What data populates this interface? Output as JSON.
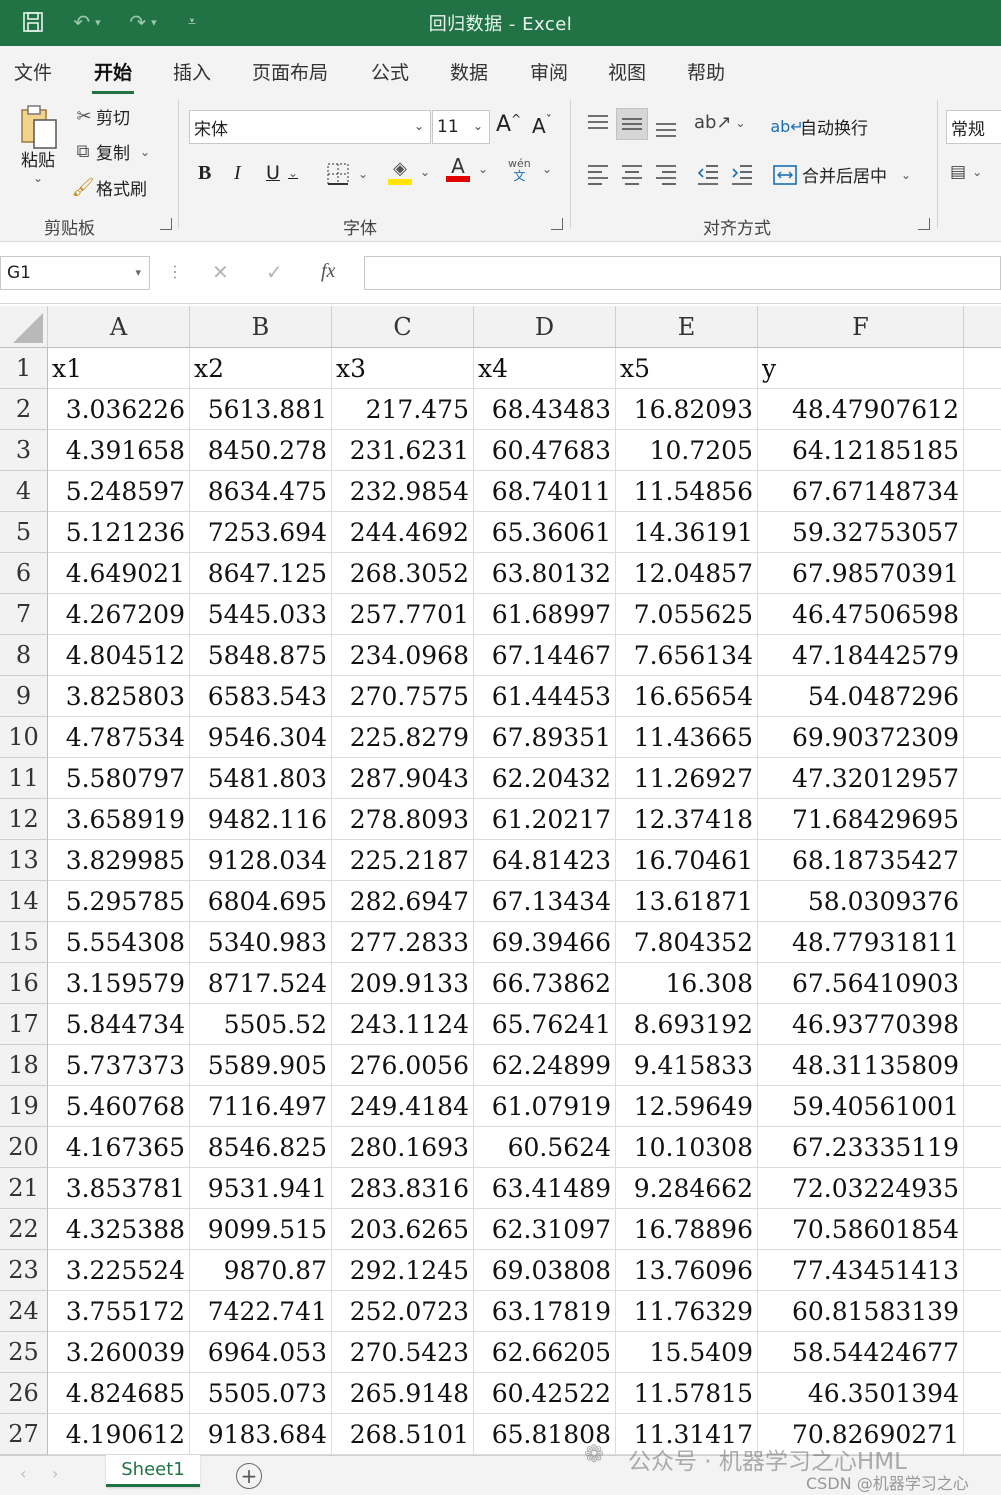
{
  "titlebar": {
    "title": "回归数据  -  Excel",
    "save_icon": "save-icon",
    "undo_icon": "undo-icon",
    "redo_icon": "redo-icon",
    "customize_icon": "customize-quick-access-icon"
  },
  "menu": {
    "tabs": [
      "文件",
      "开始",
      "插入",
      "页面布局",
      "公式",
      "数据",
      "审阅",
      "视图",
      "帮助"
    ],
    "active": "开始"
  },
  "ribbon": {
    "clipboard": {
      "paste": "粘贴",
      "cut": "剪切",
      "copy": "复制",
      "format_painter": "格式刷",
      "label": "剪贴板"
    },
    "font": {
      "name": "宋体",
      "size": "11",
      "grow": "A",
      "shrink": "A",
      "bold": "B",
      "italic": "I",
      "underline": "U",
      "label": "字体",
      "phonetic_top": "wén",
      "phonetic_bottom": "文"
    },
    "alignment": {
      "wrap_text": "自动换行",
      "merge_center": "合并后居中",
      "label": "对齐方式"
    },
    "number": {
      "format": "常规"
    }
  },
  "formula_bar": {
    "name_box": "G1",
    "cancel": "✕",
    "enter": "✓",
    "fx": "fx",
    "value": ""
  },
  "sheet": {
    "columns": [
      "A",
      "B",
      "C",
      "D",
      "E",
      "F"
    ],
    "header_row": [
      "x1",
      "x2",
      "x3",
      "x4",
      "x5",
      "y"
    ],
    "row_numbers": [
      "1",
      "2",
      "3",
      "4",
      "5",
      "6",
      "7",
      "8",
      "9",
      "10",
      "11",
      "12",
      "13",
      "14",
      "15",
      "16",
      "17",
      "18",
      "19",
      "20",
      "21",
      "22",
      "23",
      "24",
      "25",
      "26",
      "27"
    ],
    "rows": [
      [
        "3.036226",
        "5613.881",
        "217.475",
        "68.43483",
        "16.82093",
        "48.47907612"
      ],
      [
        "4.391658",
        "8450.278",
        "231.6231",
        "60.47683",
        "10.7205",
        "64.12185185"
      ],
      [
        "5.248597",
        "8634.475",
        "232.9854",
        "68.74011",
        "11.54856",
        "67.67148734"
      ],
      [
        "5.121236",
        "7253.694",
        "244.4692",
        "65.36061",
        "14.36191",
        "59.32753057"
      ],
      [
        "4.649021",
        "8647.125",
        "268.3052",
        "63.80132",
        "12.04857",
        "67.98570391"
      ],
      [
        "4.267209",
        "5445.033",
        "257.7701",
        "61.68997",
        "7.055625",
        "46.47506598"
      ],
      [
        "4.804512",
        "5848.875",
        "234.0968",
        "67.14467",
        "7.656134",
        "47.18442579"
      ],
      [
        "3.825803",
        "6583.543",
        "270.7575",
        "61.44453",
        "16.65654",
        "54.0487296"
      ],
      [
        "4.787534",
        "9546.304",
        "225.8279",
        "67.89351",
        "11.43665",
        "69.90372309"
      ],
      [
        "5.580797",
        "5481.803",
        "287.9043",
        "62.20432",
        "11.26927",
        "47.32012957"
      ],
      [
        "3.658919",
        "9482.116",
        "278.8093",
        "61.20217",
        "12.37418",
        "71.68429695"
      ],
      [
        "3.829985",
        "9128.034",
        "225.2187",
        "64.81423",
        "16.70461",
        "68.18735427"
      ],
      [
        "5.295785",
        "6804.695",
        "282.6947",
        "67.13434",
        "13.61871",
        "58.0309376"
      ],
      [
        "5.554308",
        "5340.983",
        "277.2833",
        "69.39466",
        "7.804352",
        "48.77931811"
      ],
      [
        "3.159579",
        "8717.524",
        "209.9133",
        "66.73862",
        "16.308",
        "67.56410903"
      ],
      [
        "5.844734",
        "5505.52",
        "243.1124",
        "65.76241",
        "8.693192",
        "46.93770398"
      ],
      [
        "5.737373",
        "5589.905",
        "276.0056",
        "62.24899",
        "9.415833",
        "48.31135809"
      ],
      [
        "5.460768",
        "7116.497",
        "249.4184",
        "61.07919",
        "12.59649",
        "59.40561001"
      ],
      [
        "4.167365",
        "8546.825",
        "280.1693",
        "60.5624",
        "10.10308",
        "67.23335119"
      ],
      [
        "3.853781",
        "9531.941",
        "283.8316",
        "63.41489",
        "9.284662",
        "72.03224935"
      ],
      [
        "4.325388",
        "9099.515",
        "203.6265",
        "62.31097",
        "16.78896",
        "70.58601854"
      ],
      [
        "3.225524",
        "9870.87",
        "292.1245",
        "69.03808",
        "13.76096",
        "77.43451413"
      ],
      [
        "3.755172",
        "7422.741",
        "252.0723",
        "63.17819",
        "11.76329",
        "60.81583139"
      ],
      [
        "3.260039",
        "6964.053",
        "270.5423",
        "62.66205",
        "15.5409",
        "58.54424677"
      ],
      [
        "4.824685",
        "5505.073",
        "265.9148",
        "60.42522",
        "11.57815",
        "46.3501394"
      ],
      [
        "4.190612",
        "9183.684",
        "268.5101",
        "65.81808",
        "11.31417",
        "70.82690271"
      ]
    ]
  },
  "tabs": {
    "sheet_name": "Sheet1",
    "add": "+"
  },
  "watermark": {
    "line1": "公众号 · 机器学习之心HML",
    "line2": "CSDN @机器学习之心"
  },
  "colors": {
    "excel_green": "#217346",
    "font_color_red": "#e00000",
    "highlight_yellow": "#ffe600"
  }
}
